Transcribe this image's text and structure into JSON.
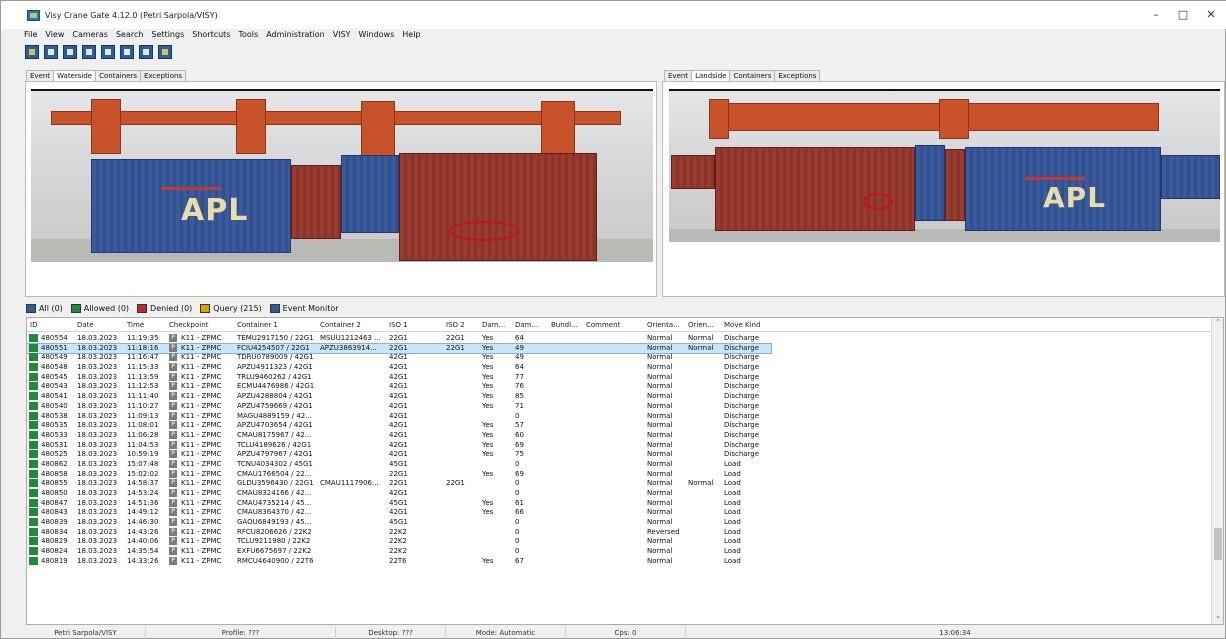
{
  "window": {
    "title": "Visy Crane Gate 4.12.0 (Petri Sarpola/VISY)"
  },
  "menu": [
    "File",
    "View",
    "Cameras",
    "Search",
    "Settings",
    "Shortcuts",
    "Tools",
    "Administration",
    "VISY",
    "Windows",
    "Help"
  ],
  "toolbar": {
    "button_count": 8
  },
  "left_pane": {
    "tabs": [
      "Event",
      "Waterside",
      "Containers",
      "Exceptions"
    ],
    "active": "Waterside",
    "logo_text": "APL"
  },
  "right_pane": {
    "tabs": [
      "Event",
      "Landside",
      "Containers",
      "Exceptions"
    ],
    "active": "Landside",
    "logo_text": "APL"
  },
  "filters": [
    {
      "label": "All (0)",
      "color": "#2c5e96"
    },
    {
      "label": "Allowed (0)",
      "color": "#1e8a3a"
    },
    {
      "label": "Denied (0)",
      "color": "#c62828"
    },
    {
      "label": "Query (215)",
      "color": "#d9a400"
    },
    {
      "label": "Event Monitor",
      "color": "#2c5e96"
    }
  ],
  "table": {
    "headers": [
      "ID",
      "Date",
      "Time",
      "Checkpoint",
      "Container 1",
      "Container 2",
      "ISO 1",
      "ISO 2",
      "Dam...",
      "Dam...",
      "Bundl...",
      "Comment",
      "Orienta...",
      "Orien...",
      "Move Kind"
    ],
    "selected_id": "480551",
    "rows": [
      [
        "480554",
        "18.03.2023",
        "11:19:35",
        "K11 - ZPMC",
        "TEMU2917150 / 22G1",
        "MSUU1212463 ...",
        "22G1",
        "22G1",
        "Yes",
        "64",
        "",
        "",
        "Normal",
        "Normal",
        "Discharge"
      ],
      [
        "480551",
        "18.03.2023",
        "11:18:16",
        "K11 - ZPMC",
        "FCIU4254507 / 22G1",
        "APZU3863914...",
        "22G1",
        "22G1",
        "Yes",
        "49",
        "",
        "",
        "Normal",
        "Normal",
        "Discharge"
      ],
      [
        "480549",
        "18.03.2023",
        "11:16:47",
        "K11 - ZPMC",
        "TDRU0789009 / 42G1",
        "",
        "42G1",
        "",
        "Yes",
        "49",
        "",
        "",
        "Normal",
        "",
        "Discharge"
      ],
      [
        "480548",
        "18.03.2023",
        "11:15:33",
        "K11 - ZPMC",
        "APZU4911323 / 42G1",
        "",
        "42G1",
        "",
        "Yes",
        "64",
        "",
        "",
        "Normal",
        "",
        "Discharge"
      ],
      [
        "480545",
        "18.03.2023",
        "11:13:59",
        "K11 - ZPMC",
        "TRLU9460262 / 42G1",
        "",
        "42G1",
        "",
        "Yes",
        "77",
        "",
        "",
        "Normal",
        "",
        "Discharge"
      ],
      [
        "480543",
        "18.03.2023",
        "11:12:53",
        "K11 - ZPMC",
        "ECMU4476986 / 42G1",
        "",
        "42G1",
        "",
        "Yes",
        "76",
        "",
        "",
        "Normal",
        "",
        "Discharge"
      ],
      [
        "480541",
        "18.03.2023",
        "11:11:40",
        "K11 - ZPMC",
        "APZU4288804 / 42G1",
        "",
        "42G1",
        "",
        "Yes",
        "85",
        "",
        "",
        "Normal",
        "",
        "Discharge"
      ],
      [
        "480540",
        "18.03.2023",
        "11:10:27",
        "K11 - ZPMC",
        "APZU4759669 / 42G1",
        "",
        "42G1",
        "",
        "Yes",
        "71",
        "",
        "",
        "Normal",
        "",
        "Discharge"
      ],
      [
        "480538",
        "18.03.2023",
        "11:09:13",
        "K11 - ZPMC",
        "MAGU4889159 / 42...",
        "",
        "42G1",
        "",
        "",
        "0",
        "",
        "",
        "Normal",
        "",
        "Discharge"
      ],
      [
        "480535",
        "18.03.2023",
        "11:08:01",
        "K11 - ZPMC",
        "APZU4703654 / 42G1",
        "",
        "42G1",
        "",
        "Yes",
        "57",
        "",
        "",
        "Normal",
        "",
        "Discharge"
      ],
      [
        "480533",
        "18.03.2023",
        "11:06:28",
        "K11 - ZPMC",
        "CMAU8175967 / 42...",
        "",
        "42G1",
        "",
        "Yes",
        "60",
        "",
        "",
        "Normal",
        "",
        "Discharge"
      ],
      [
        "480531",
        "18.03.2023",
        "11:04:53",
        "K11 - ZPMC",
        "TCLU4189626 / 42G1",
        "",
        "42G1",
        "",
        "Yes",
        "69",
        "",
        "",
        "Normal",
        "",
        "Discharge"
      ],
      [
        "480525",
        "18.03.2023",
        "10:59:19",
        "K11 - ZPMC",
        "APZU4797967 / 42G1",
        "",
        "42G1",
        "",
        "Yes",
        "75",
        "",
        "",
        "Normal",
        "",
        "Discharge"
      ],
      [
        "480862",
        "18.03.2023",
        "15:07:48",
        "K11 - ZPMC",
        "TCNU4034302 / 45G1",
        "",
        "45G1",
        "",
        "",
        "0",
        "",
        "",
        "Normal",
        "",
        "Load"
      ],
      [
        "480858",
        "18.03.2023",
        "15:02:02",
        "K11 - ZPMC",
        "CMAU1766504 / 22...",
        "",
        "22G1",
        "",
        "Yes",
        "69",
        "",
        "",
        "Normal",
        "",
        "Load"
      ],
      [
        "480855",
        "18.03.2023",
        "14:58:37",
        "K11 - ZPMC",
        "GLDU3596430 / 22G1",
        "CMAU1117906...",
        "22G1",
        "22G1",
        "",
        "0",
        "",
        "",
        "Normal",
        "Normal",
        "Load"
      ],
      [
        "480850",
        "18.03.2023",
        "14:53:24",
        "K11 - ZPMC",
        "CMAU8324166 / 42...",
        "",
        "42G1",
        "",
        "",
        "0",
        "",
        "",
        "Normal",
        "",
        "Load"
      ],
      [
        "480847",
        "18.03.2023",
        "14:51:36",
        "K11 - ZPMC",
        "CMAU4735214 / 45...",
        "",
        "45G1",
        "",
        "Yes",
        "61",
        "",
        "",
        "Normal",
        "",
        "Load"
      ],
      [
        "480843",
        "18.03.2023",
        "14:49:12",
        "K11 - ZPMC",
        "CMAU8364370 / 42...",
        "",
        "42G1",
        "",
        "Yes",
        "66",
        "",
        "",
        "Normal",
        "",
        "Load"
      ],
      [
        "480839",
        "18.03.2023",
        "14:46:30",
        "K11 - ZPMC",
        "GAOU6849193 / 45...",
        "",
        "45G1",
        "",
        "",
        "0",
        "",
        "",
        "Normal",
        "",
        "Load"
      ],
      [
        "480834",
        "18.03.2023",
        "14:43:26",
        "K11 - ZPMC",
        "RFCU8206626 / 22K2",
        "",
        "22K2",
        "",
        "",
        "0",
        "",
        "",
        "Reversed",
        "",
        "Load"
      ],
      [
        "480829",
        "18.03.2023",
        "14:40:06",
        "K11 - ZPMC",
        "TCLU9211980 / 22K2",
        "",
        "22K2",
        "",
        "",
        "0",
        "",
        "",
        "Normal",
        "",
        "Load"
      ],
      [
        "480824",
        "18.03.2023",
        "14:35:54",
        "K11 - ZPMC",
        "EXFU6675697 / 22K2",
        "",
        "22K2",
        "",
        "",
        "0",
        "",
        "",
        "Normal",
        "",
        "Load"
      ],
      [
        "480819",
        "18.03.2023",
        "14:33:26",
        "K11 - ZPMC",
        "RMCU4640900 / 22T6",
        "",
        "22T6",
        "",
        "Yes",
        "67",
        "",
        "",
        "Normal",
        "",
        "Load"
      ]
    ]
  },
  "status": {
    "user": "Petri Sarpola/VISY",
    "profile": "Profile: ???",
    "desktop": "Desktop: ???",
    "mode": "Mode: Automatic",
    "cps": "Cps: 0",
    "time": "13:06:34"
  }
}
